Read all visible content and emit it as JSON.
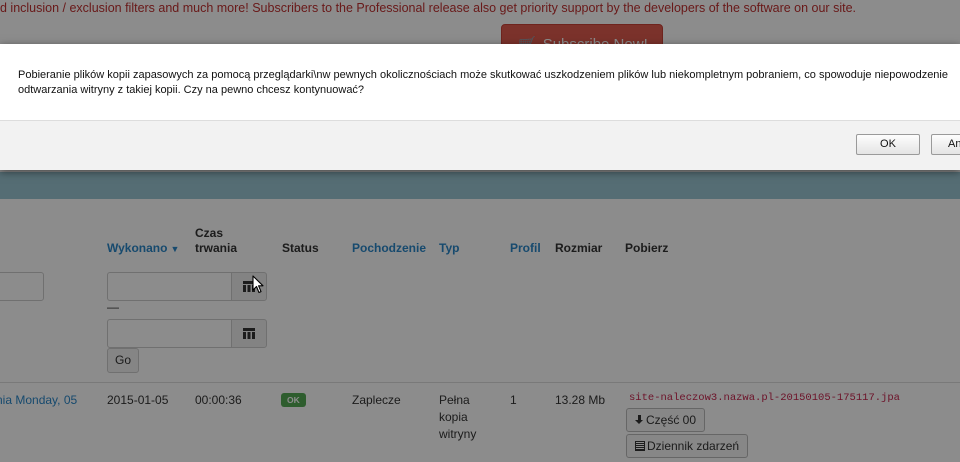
{
  "background": {
    "notice": "d inclusion / exclusion filters and much more! Subscribers to the Professional release also get priority support by the developers of the software on our site.",
    "subscribe_button": "Subscribe Now!",
    "table": {
      "headers": {
        "executed": "Wykonano",
        "duration_line1": "Czas",
        "duration_line2": "trwania",
        "status": "Status",
        "origin": "Pochodzenie",
        "type": "Typ",
        "profile": "Profil",
        "size": "Rozmiar",
        "download": "Pobierz"
      },
      "filter": {
        "date_separator": "—",
        "go_button": "Go"
      },
      "rows": [
        {
          "description": "nia Monday, 05",
          "date": "2015-01-05",
          "duration": "00:00:36",
          "status": "OK",
          "origin": "Zaplecze",
          "type": "Pełna kopia witryny",
          "profile": "1",
          "size": "13.28 Mb",
          "file_name": "site-naleczow3.nazwa.pl-20150105-175117.jpa",
          "part_button": "Część 00",
          "log_button": "Dziennik zdarzeń"
        }
      ]
    }
  },
  "dialog": {
    "message": "Pobieranie plików kopii zapasowych za pomocą przeglądarki\\nw pewnych okolicznościach może skutkować uszkodzeniem plików lub niekompletnym pobraniem, co spowoduje niepowodzenie odtwarzania witryny  z takiej kopii. Czy na pewno chcesz kontynuować?",
    "ok_button": "OK",
    "cancel_button": "Anuluj"
  },
  "icons": {
    "cart": "shopping-cart-icon",
    "calendar": "calendar-icon",
    "download": "download-icon",
    "log": "list-icon",
    "cursor": "mouse-pointer-icon"
  },
  "colors": {
    "accent_link": "#2a87c9",
    "subscribe_red": "#e15b4f",
    "status_ok_green": "#55a955",
    "file_link_red": "#c7254e",
    "header_bar_teal": "#9bc6d4"
  }
}
